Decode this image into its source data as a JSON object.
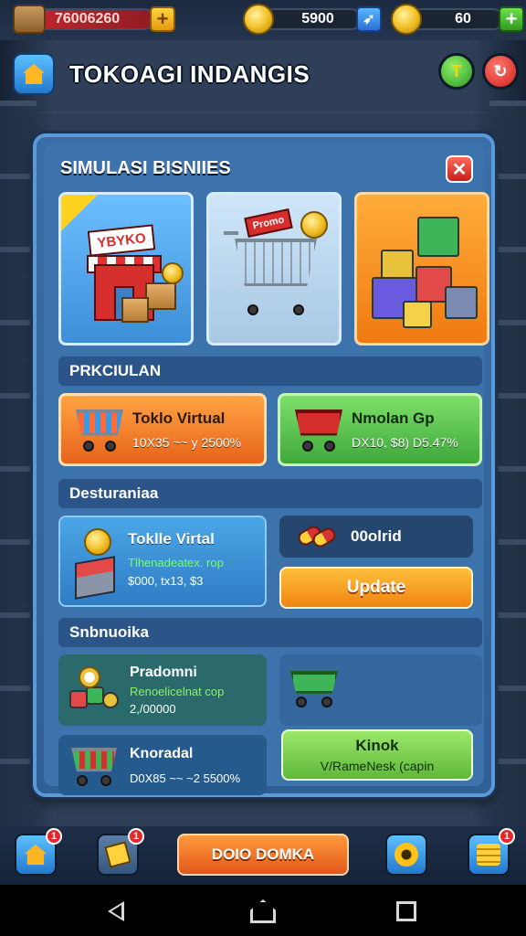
{
  "topbar": {
    "cash": "76006260",
    "coins": "5900",
    "gems": "60"
  },
  "header": {
    "title": "TOKOAGI INDANGIS",
    "green_button_label": "T"
  },
  "panel": {
    "title": "SIMULASI BISNIIES",
    "close_label": "✕",
    "cards": {
      "shop_sign": "YBYKO",
      "cart_sign": "Promo"
    },
    "sections": {
      "penjualan": "PRKCIULAN",
      "desturaniaa": "Desturaniaa",
      "snbnuoika": "Snbnuoika"
    },
    "sales_items": [
      {
        "title": "Toklo Virtual",
        "stats": "10X35 ~~ y 2500%"
      },
      {
        "title": "Nmolan Gp",
        "stats": "DX10, $8) D5.47%"
      }
    ],
    "dest_card": {
      "title": "Toklle Virtal",
      "line2": "Tlhenadeatex. rop",
      "line3": "$000, tx13, $3"
    },
    "dest_right": {
      "label": "00olrid"
    },
    "update_button": "Update",
    "snb_card": {
      "title": "Pradomni",
      "line2": "Renoelicelnat cop",
      "line3": "2,/00000"
    },
    "knoradal": {
      "title": "Knoradal",
      "stats": "D0X85 ~~ ~2 5500%"
    },
    "kinok_button": {
      "title": "Kinok",
      "subtitle": "V/RameNesk (capin"
    }
  },
  "dock": {
    "home_badge": "1",
    "shop_badge": "1",
    "main_button": "DOIO DOMKA",
    "coins_badge": "1"
  },
  "colors": {
    "panel_blue": "#3d73ad",
    "accent_orange": "#f08410",
    "accent_green": "#3ea83a",
    "badge_red": "#e22a2a"
  },
  "icons": [
    "box-icon",
    "coin-icon",
    "plus-icon",
    "home-icon",
    "close-icon",
    "cart-icon",
    "gear-icon",
    "coin-stack-icon",
    "pill-icon",
    "back-icon",
    "recent-apps-icon"
  ]
}
